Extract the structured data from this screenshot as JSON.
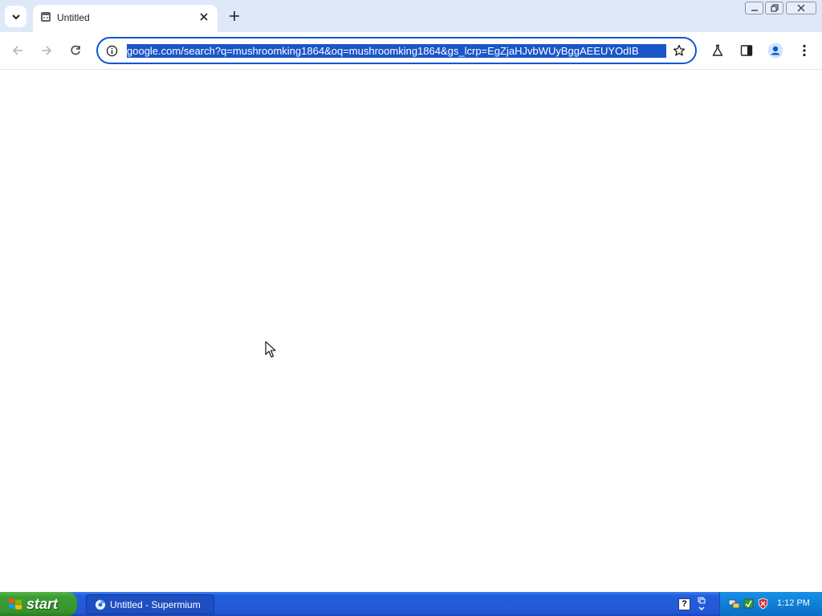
{
  "browser": {
    "tab": {
      "title": "Untitled"
    },
    "omnibox": {
      "url": "google.com/search?q=mushroomking1864&oq=mushroomking1864&gs_lcrp=EgZjaHJvbWUyBggAEEUYOdIB"
    }
  },
  "taskbar": {
    "start_label": "start",
    "task_item_label": "Untitled - Supermium",
    "help_label": "?",
    "clock": "1:12 PM"
  },
  "colors": {
    "tabstrip_bg": "#dfe8f8",
    "omnibox_border": "#0b57d0",
    "url_selection": "#1a56c8",
    "taskbar_blue": "#245edb",
    "start_green": "#3c9d32"
  }
}
